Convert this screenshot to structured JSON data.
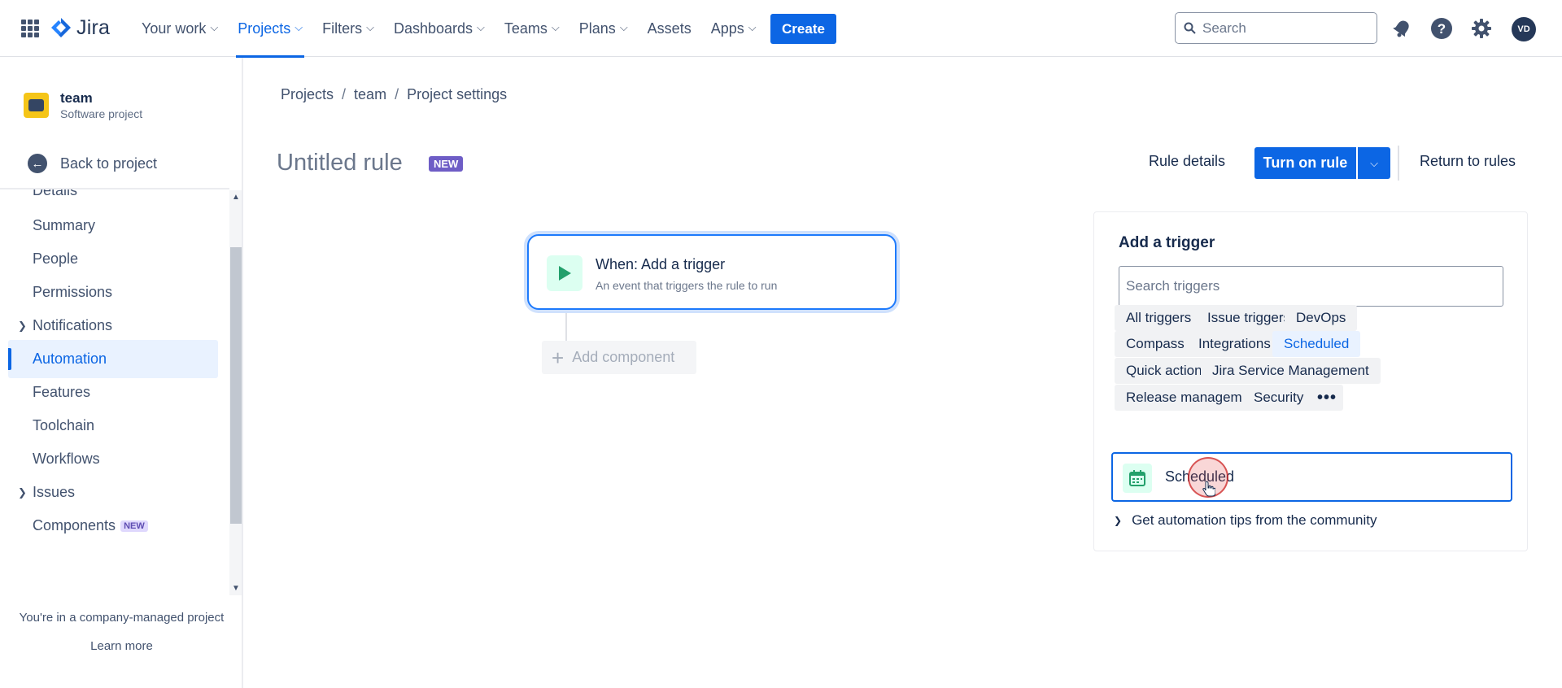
{
  "topnav": {
    "logo_text": "Jira",
    "items": [
      {
        "label": "Your work",
        "has_dropdown": true
      },
      {
        "label": "Projects",
        "has_dropdown": true,
        "active": true
      },
      {
        "label": "Filters",
        "has_dropdown": true
      },
      {
        "label": "Dashboards",
        "has_dropdown": true
      },
      {
        "label": "Teams",
        "has_dropdown": true
      },
      {
        "label": "Plans",
        "has_dropdown": true
      },
      {
        "label": "Assets",
        "has_dropdown": false
      },
      {
        "label": "Apps",
        "has_dropdown": true
      }
    ],
    "create_label": "Create",
    "search_placeholder": "Search",
    "avatar_initials": "VD",
    "accent_color": "#0c66e4"
  },
  "sidebar": {
    "project_name": "team",
    "project_type": "Software project",
    "back_label": "Back to project",
    "items": [
      {
        "label": "Details",
        "expandable": false
      },
      {
        "label": "Summary",
        "expandable": false
      },
      {
        "label": "People",
        "expandable": false
      },
      {
        "label": "Permissions",
        "expandable": false
      },
      {
        "label": "Notifications",
        "expandable": true
      },
      {
        "label": "Automation",
        "expandable": false,
        "active": true
      },
      {
        "label": "Features",
        "expandable": false
      },
      {
        "label": "Toolchain",
        "expandable": false
      },
      {
        "label": "Workflows",
        "expandable": false
      },
      {
        "label": "Issues",
        "expandable": true
      },
      {
        "label": "Components",
        "expandable": false,
        "badge": "NEW"
      }
    ],
    "company_note": "You're in a company-managed project",
    "learn_more": "Learn more"
  },
  "breadcrumb": [
    "Projects",
    "team",
    "Project settings"
  ],
  "rule": {
    "title": "Untitled rule",
    "badge": "NEW",
    "details_label": "Rule details",
    "turn_on_label": "Turn on rule",
    "return_label": "Return to rules"
  },
  "canvas": {
    "trigger_title": "When: Add a trigger",
    "trigger_subtitle": "An event that triggers the rule to run",
    "add_component_label": "Add component"
  },
  "trigger_panel": {
    "title": "Add a trigger",
    "search_placeholder": "Search triggers",
    "categories": [
      {
        "label": "All triggers"
      },
      {
        "label": "Issue triggers"
      },
      {
        "label": "DevOps"
      },
      {
        "label": "Compass"
      },
      {
        "label": "Integrations"
      },
      {
        "label": "Scheduled",
        "selected": true
      },
      {
        "label": "Quick actions"
      },
      {
        "label": "Jira Service Management"
      },
      {
        "label": "Release management"
      },
      {
        "label": "Security"
      },
      {
        "label": "•••",
        "more": true
      }
    ],
    "result_label": "Scheduled",
    "result_icon": "calendar-icon",
    "tips_label": "Get automation tips from the community"
  }
}
